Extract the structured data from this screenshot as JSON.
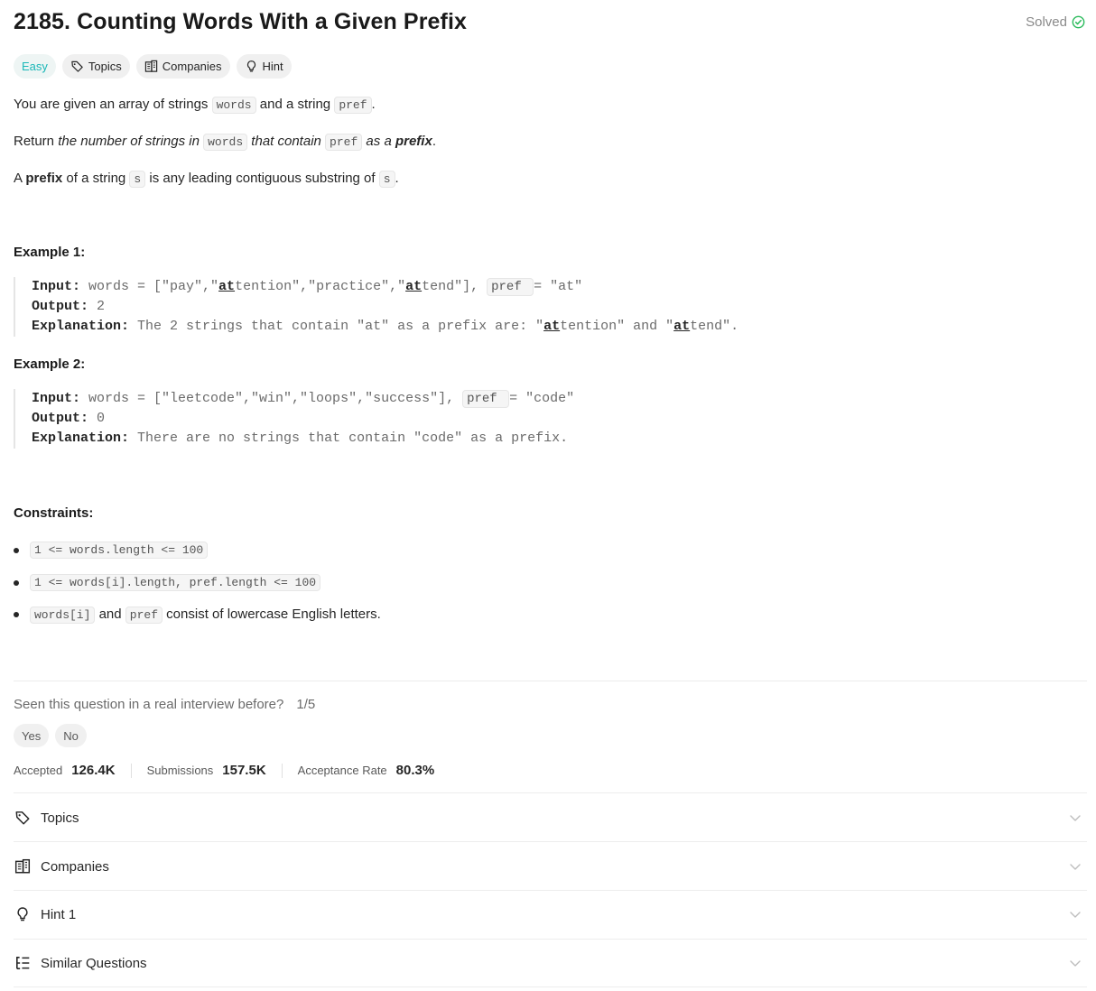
{
  "header": {
    "title": "2185. Counting Words With a Given Prefix",
    "status": "Solved"
  },
  "tags": {
    "difficulty": "Easy",
    "topics": "Topics",
    "companies": "Companies",
    "hint": "Hint"
  },
  "description": {
    "p1_a": "You are given an array of strings ",
    "p1_code1": "words",
    "p1_b": " and a string ",
    "p1_code2": "pref",
    "p1_c": ".",
    "p2_a": "Return ",
    "p2_i1": "the number of strings in ",
    "p2_code1": "words",
    "p2_i2": " that contain ",
    "p2_code2": "pref",
    "p2_i3": " as a ",
    "p2_bi": "prefix",
    "p2_end": ".",
    "p3_a": "A ",
    "p3_b": "prefix",
    "p3_c": " of a string ",
    "p3_code1": "s",
    "p3_d": " is any leading contiguous substring of ",
    "p3_code2": "s",
    "p3_e": "."
  },
  "example1": {
    "heading": "Example 1:",
    "input_label": "Input:",
    "input_a": " words = [\"pay\",\"",
    "input_u1": "at",
    "input_b": "tention\",\"practice\",\"",
    "input_u2": "at",
    "input_c": "tend\"], ",
    "input_code": "pref ",
    "input_d": "= \"at\"",
    "output_label": "Output:",
    "output_value": " 2",
    "expl_label": "Explanation:",
    "expl_a": " The 2 strings that contain \"at\" as a prefix are: \"",
    "expl_u1": "at",
    "expl_b": "tention\" and \"",
    "expl_u2": "at",
    "expl_c": "tend\"."
  },
  "example2": {
    "heading": "Example 2:",
    "input_label": "Input:",
    "input_a": " words = [\"leetcode\",\"win\",\"loops\",\"success\"], ",
    "input_code": "pref ",
    "input_b": "= \"code\"",
    "output_label": "Output:",
    "output_value": " 0",
    "expl_label": "Explanation:",
    "expl_a": " There are no strings that contain \"code\" as a prefix."
  },
  "constraints": {
    "heading": "Constraints:",
    "c1": "1 <= words.length <= 100",
    "c2": "1 <= words[i].length, pref.length <= 100",
    "c3_code1": "words[i]",
    "c3_a": " and ",
    "c3_code2": "pref",
    "c3_b": " consist of lowercase English letters."
  },
  "interview": {
    "question": "Seen this question in a real interview before?",
    "ratio": "1/5",
    "yes": "Yes",
    "no": "No"
  },
  "stats": {
    "accepted_label": "Accepted",
    "accepted_value": "126.4K",
    "submissions_label": "Submissions",
    "submissions_value": "157.5K",
    "rate_label": "Acceptance Rate",
    "rate_value": "80.3%"
  },
  "accordion": {
    "topics": "Topics",
    "companies": "Companies",
    "hint1": "Hint 1",
    "similar": "Similar Questions"
  },
  "colors": {
    "easy": "#1cb8b8",
    "solved_check": "#2cbb5d"
  }
}
